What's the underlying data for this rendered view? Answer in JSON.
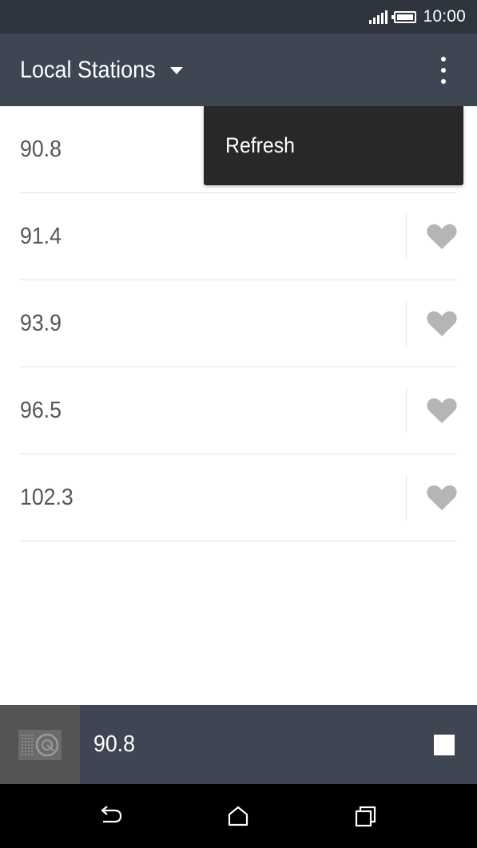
{
  "status_bar": {
    "time": "10:00",
    "icons": [
      "signal-icon",
      "battery-icon"
    ]
  },
  "app_bar": {
    "title": "Local Stations",
    "dropdown_icon": "caret-down-icon",
    "menu_icon": "overflow-menu-icon"
  },
  "stations": [
    {
      "frequency": "90.8",
      "favorite_icon": "heart-icon"
    },
    {
      "frequency": "91.4",
      "favorite_icon": "heart-icon"
    },
    {
      "frequency": "93.9",
      "favorite_icon": "heart-icon"
    },
    {
      "frequency": "96.5",
      "favorite_icon": "heart-icon"
    },
    {
      "frequency": "102.3",
      "favorite_icon": "heart-icon"
    }
  ],
  "popup_menu": {
    "items": [
      {
        "label": "Refresh"
      }
    ]
  },
  "now_playing": {
    "frequency": "90.8",
    "thumbnail_icon": "radio-icon",
    "stop_icon": "stop-icon"
  },
  "nav_bar": {
    "buttons": [
      "back-icon",
      "home-icon",
      "recent-apps-icon"
    ]
  },
  "colors": {
    "status_bar": "#2f353e",
    "app_bar": "#3f4653",
    "popup": "#282828",
    "heart": "#b5b5b5",
    "station_text": "#555555"
  }
}
